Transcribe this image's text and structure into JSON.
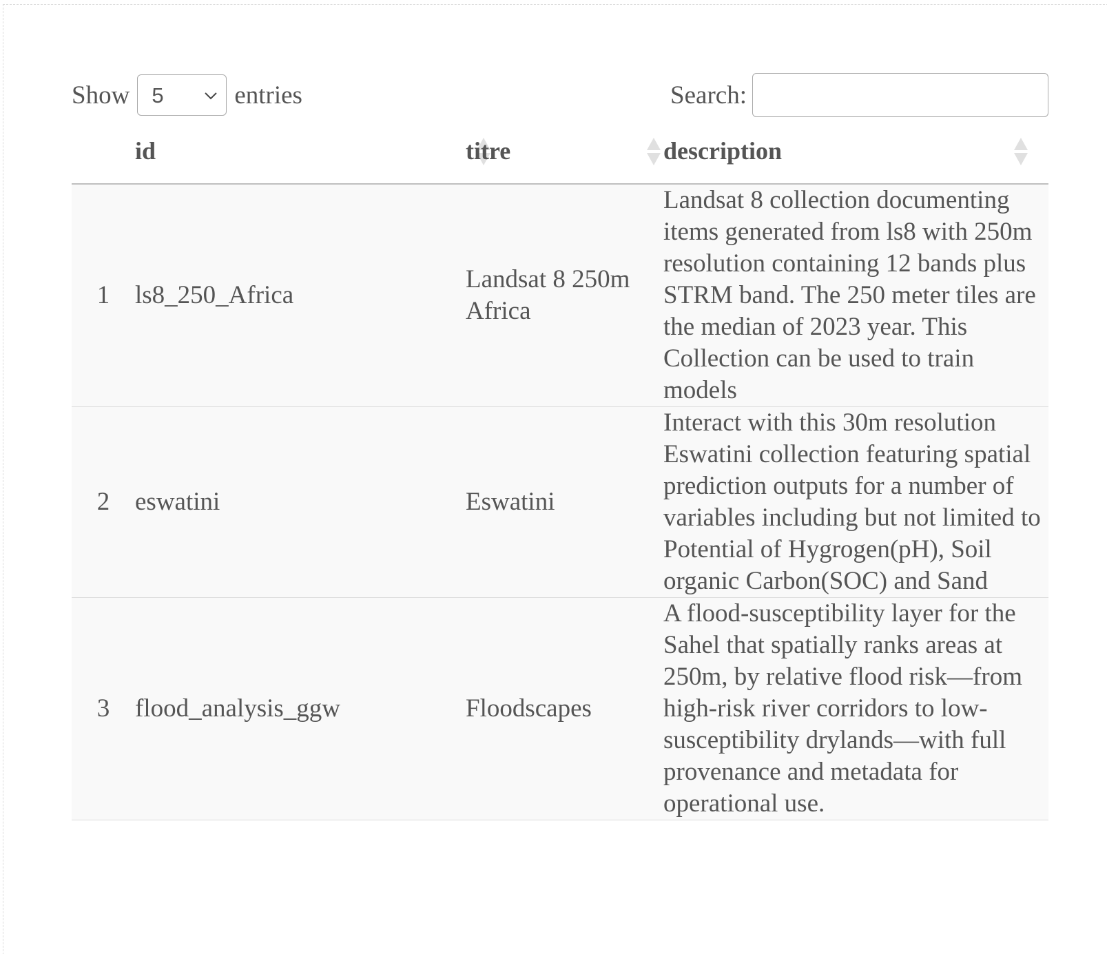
{
  "length_menu": {
    "prefix": "Show",
    "selected": "5",
    "suffix": "entries"
  },
  "search": {
    "label": "Search:",
    "value": "",
    "placeholder": ""
  },
  "table": {
    "columns": [
      "",
      "id",
      "titre",
      "description"
    ],
    "rows": [
      {
        "num": "1",
        "id": "ls8_250_Africa",
        "titre": "Landsat 8 250m Africa",
        "description": "Landsat 8 collection documenting items generated from ls8 with 250m resolution containing 12 bands plus STRM band. The 250 meter tiles are the median of 2023 year. This Collection can be used to train models"
      },
      {
        "num": "2",
        "id": "eswatini",
        "titre": "Eswatini",
        "description": "Interact with this 30m resolution Eswatini collection featuring spatial prediction outputs for a number of variables including but not limited to Potential of Hygrogen(pH), Soil organic Carbon(SOC) and Sand"
      },
      {
        "num": "3",
        "id": "flood_analysis_ggw",
        "titre": "Floodscapes",
        "description": "A flood-susceptibility layer for the Sahel that spatially ranks areas at 250m, by relative flood risk—from high-risk river corridors to low-susceptibility drylands—with full provenance and metadata for operational use."
      }
    ]
  },
  "icons": {
    "sort": "sort-both-icon",
    "select": "chevron-down-icon"
  },
  "colors": {
    "text": "#555555",
    "row_background": "#f9f9f9",
    "header_border": "#bfbfbf",
    "sort_arrow": "#e0e0e0"
  }
}
